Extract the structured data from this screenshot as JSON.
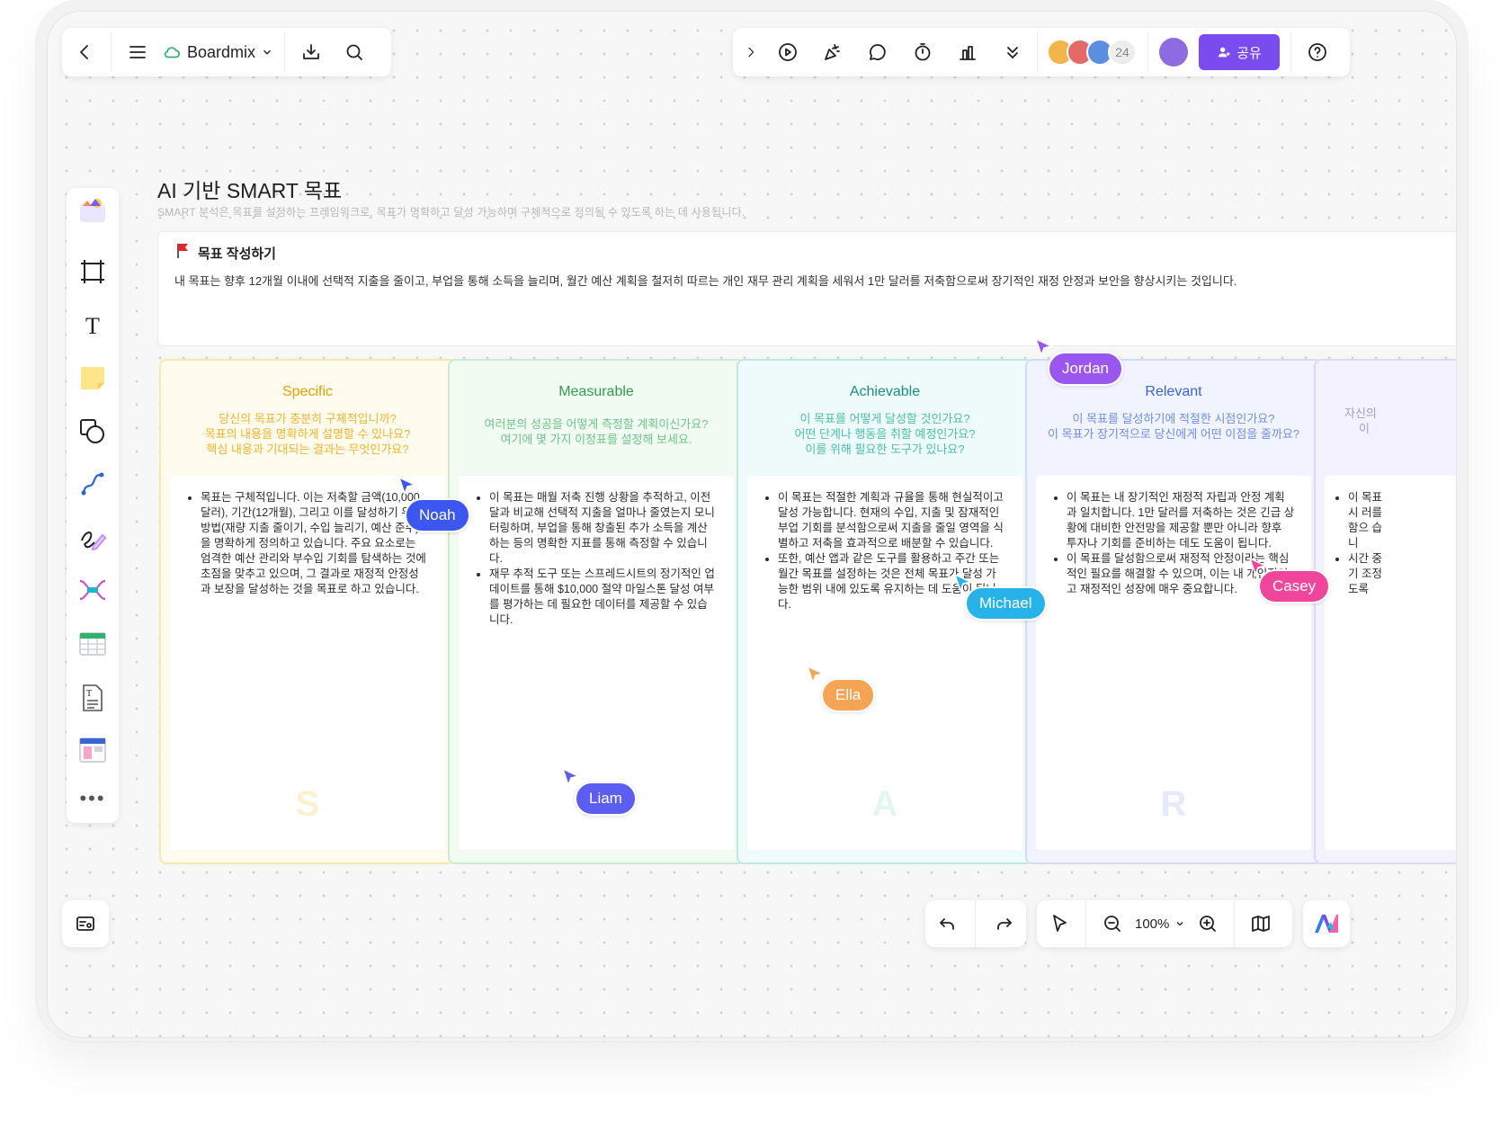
{
  "topbar_left": {
    "app_name": "Boardmix"
  },
  "topbar_right": {
    "collaborator_count": "24",
    "share_label": "공유"
  },
  "doc": {
    "title": "AI 기반 SMART 목표",
    "subtitle": "SMART 분석은 목표를 설정하는 프레임워크로, 목표가 명확하고 달성 가능하며 구체적으로 정의될 수 있도록 하는 데 사용됩니다.",
    "goal_heading": "목표 작성하기",
    "goal_text": "내 목표는 향후 12개월 이내에 선택적 지출을 줄이고, 부업을 통해 소득을 늘리며, 월간 예산 계획을 철저히 따르는 개인 재무 관리 계획을 세워서 1만 달러를 저축함으로써 장기적인 재정 안정과 보안을 향상시키는 것입니다."
  },
  "cards": [
    {
      "title": "Specific",
      "questions": [
        "당신의 목표가 충분히 구체적입니까?",
        "목표의 내용을 명확하게 설명할 수 있나요?",
        "핵심 내용과 기대되는 결과는 무엇인가요?"
      ],
      "bullets": [
        "목표는 구체적입니다. 이는 저축할 금액(10,000달러), 기간(12개월), 그리고 이를 달성하기 위한 방법(재량 지출 줄이기, 수입 늘리기, 예산 준수)을 명확하게 정의하고 있습니다. 주요 요소로는 엄격한 예산 관리와 부수입 기회를 탐색하는 것에 초점을 맞추고 있으며, 그 결과로 재정적 안정성과 보장을 달성하는 것을 목표로 하고 있습니다."
      ],
      "letter": "S",
      "color": "#e3a300"
    },
    {
      "title": "Measurable",
      "questions": [
        "여러분의 성공을 어떻게 측정할 계획이신가요?",
        "여기에 몇 가지 이정표를 설정해 보세요."
      ],
      "bullets": [
        "이 목표는 매월 저축 진행 상황을 추적하고, 이전 달과 비교해 선택적 지출을 얼마나 줄였는지 모니터링하며, 부업을 통해 창출된 추가 소득을 계산하는 등의 명확한 지표를 통해 측정할 수 있습니다.",
        "재무 추적 도구 또는 스프레드시트의 정기적인 업데이트를 통해 $10,000 절약 마일스톤 달성 여부를 평가하는 데 필요한 데이터를 제공할 수 있습니다."
      ],
      "letter": "M",
      "color": "#2e9e4f"
    },
    {
      "title": "Achievable",
      "questions": [
        "이 목표를 어떻게 달성할 것인가요?",
        "어떤 단계나 행동을 취할 예정인가요?",
        "이를 위해 필요한 도구가 있나요?"
      ],
      "bullets": [
        "이 목표는 적절한 계획과 규율을 통해 현실적이고 달성 가능합니다. 현재의 수입, 지출 및 잠재적인 부업 기회를 분석함으로써 지출을 줄일 영역을 식별하고 저축을 효과적으로 배분할 수 있습니다.",
        "또한, 예산 앱과 같은 도구를 활용하고 주간 또는 월간 목표를 설정하는 것은 전체 목표가 달성 가능한 범위 내에 있도록 유지하는 데 도움이 됩니다."
      ],
      "letter": "A",
      "color": "#1b8f78"
    },
    {
      "title": "Relevant",
      "questions": [
        "이 목표를 달성하기에 적절한 시점인가요?",
        "이 목표가 장기적으로 당신에게 어떤 이점을 줄까요?"
      ],
      "bullets": [
        "이 목표는 내 장기적인 재정적 자립과 안정 계획과 일치합니다. 1만 달러를 저축하는 것은 긴급 상황에 대비한 안전망을 제공할 뿐만 아니라 향후 투자나 기회를 준비하는 데도 도움이 됩니다.",
        "이 목표를 달성함으로써 재정적 안정이라는 핵심적인 필요를 해결할 수 있으며, 이는 내 개인적이고 재정적인 성장에 매우 중요합니다."
      ],
      "letter": "R",
      "color": "#3a63d8"
    },
    {
      "title": "",
      "questions": [
        "자신의",
        "이"
      ],
      "bullets": [
        "이 목표 시 러를 함으 습니",
        "시간 중 기 조정 도록"
      ],
      "letter": "",
      "color": "#8a6fd6"
    }
  ],
  "collaborators": [
    {
      "name": "Noah",
      "color": "#3c57f0"
    },
    {
      "name": "Liam",
      "color": "#5b5ef0"
    },
    {
      "name": "Michael",
      "color": "#27b3ea"
    },
    {
      "name": "Ella",
      "color": "#f5a453"
    },
    {
      "name": "Jordan",
      "color": "#9a57f0"
    },
    {
      "name": "Casey",
      "color": "#f0459c"
    }
  ],
  "zoom": {
    "level": "100%"
  }
}
